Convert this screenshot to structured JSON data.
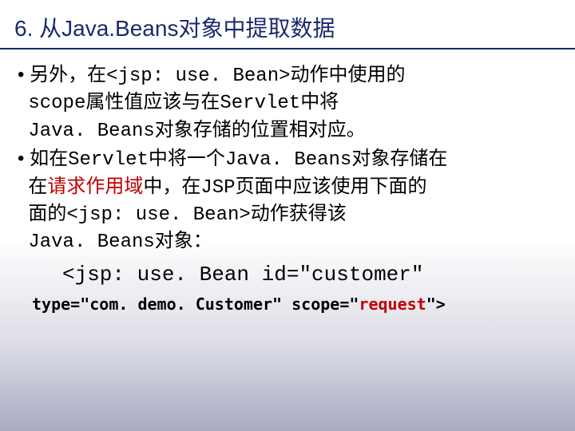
{
  "title": "6. 从Java.Beans对象中提取数据",
  "bullets": [
    {
      "pre": "另外，在",
      "tag": "<jsp: use. Bean>",
      "mid1": "动作中使用的",
      "scope": "scope",
      "mid2": "属性值应该与在",
      "servlet": "Servlet",
      "mid3": "中将",
      "jb": "Java. Beans",
      "end": "对象存储的位置相对应。"
    },
    {
      "pre": "如在",
      "servlet": "Servlet",
      "mid1": "中将一个",
      "jb1": "Java. Beans",
      "mid2": "对象存储在",
      "red": "请求作用域",
      "mid3": "中，在",
      "jsp": "JSP",
      "mid4": "页面中应该使用下面的",
      "tag": "<jsp: use. Bean>",
      "mid5": "动作获得该",
      "jb2": "Java. Beans",
      "end": "对象："
    }
  ],
  "code1": "<jsp: use. Bean id=\"customer\"",
  "code2": {
    "a": "type=\"com. demo. Customer\" scope=\"",
    "r": "request",
    "b": "\">"
  }
}
